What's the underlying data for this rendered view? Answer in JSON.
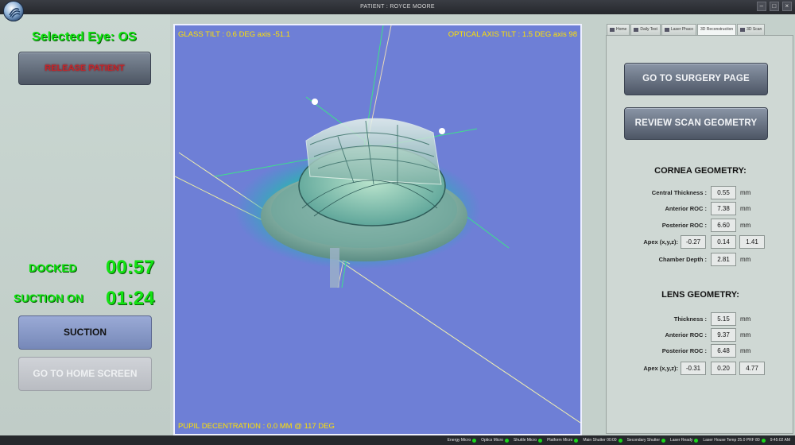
{
  "window": {
    "title": "PATIENT : ROYCE MOORE"
  },
  "left_panel": {
    "selected_eye": "Selected Eye: OS",
    "release_button": "RELEASE PATIENT",
    "docked_label": "DOCKED",
    "docked_time": "00:57",
    "suction_label": "SUCTION ON",
    "suction_time": "01:24",
    "suction_button": "SUCTION",
    "home_button": "GO TO HOME SCREEN"
  },
  "viewport": {
    "glass_tilt": "GLASS TILT : 0.6 DEG axis -51.1",
    "optical_axis_tilt": "OPTICAL AXIS TILT : 1.5 DEG axis 98",
    "pupil_decentration": "PUPIL DECENTRATION : 0.0 MM @ 117 DEG"
  },
  "tabs": [
    {
      "label": "Home",
      "active": false
    },
    {
      "label": "Daily Test",
      "active": false
    },
    {
      "label": "Laser Phaco",
      "active": false
    },
    {
      "label": "3D Reconstruction",
      "active": true
    },
    {
      "label": "3D Scan",
      "active": false
    }
  ],
  "right_panel": {
    "surgery_button": "GO TO SURGERY PAGE",
    "review_button": "REVIEW SCAN GEOMETRY",
    "cornea": {
      "title": "CORNEA GEOMETRY:",
      "central_thickness": {
        "label": "Central Thickness :",
        "value": "0.55",
        "unit": "mm"
      },
      "anterior_roc": {
        "label": "Anterior ROC :",
        "value": "7.38",
        "unit": "mm"
      },
      "posterior_roc": {
        "label": "Posterior ROC :",
        "value": "6.60",
        "unit": "mm"
      },
      "apex": {
        "label": "Apex (x,y,z):",
        "x": "-0.27",
        "y": "0.14",
        "z": "1.41"
      },
      "chamber_depth": {
        "label": "Chamber Depth :",
        "value": "2.81",
        "unit": "mm"
      }
    },
    "lens": {
      "title": "LENS GEOMETRY:",
      "thickness": {
        "label": "Thickness :",
        "value": "5.15",
        "unit": "mm"
      },
      "anterior_roc": {
        "label": "Anterior ROC :",
        "value": "9.37",
        "unit": "mm"
      },
      "posterior_roc": {
        "label": "Posterior ROC :",
        "value": "6.48",
        "unit": "mm"
      },
      "apex": {
        "label": "Apex (x,y,z):",
        "x": "-0.31",
        "y": "0.20",
        "z": "4.77"
      }
    }
  },
  "status_bar": [
    {
      "label": "Energy Micro",
      "color": "#1ad61a"
    },
    {
      "label": "Optics Micro",
      "color": "#1ad61a"
    },
    {
      "label": "Shuttle Micro",
      "color": "#1ad61a"
    },
    {
      "label": "Platform Micro",
      "color": "#1ad61a"
    },
    {
      "label": "Main Shutter 00:00",
      "color": "#1ad61a"
    },
    {
      "label": "Secondary Shutter",
      "color": "#1ad61a"
    },
    {
      "label": "Laser Ready",
      "color": "#1ad61a"
    },
    {
      "label": "Laser House Temp 25.0 PRF 80",
      "color": "#1ad61a"
    },
    {
      "label": "9:45:02 AM",
      "color": ""
    }
  ]
}
